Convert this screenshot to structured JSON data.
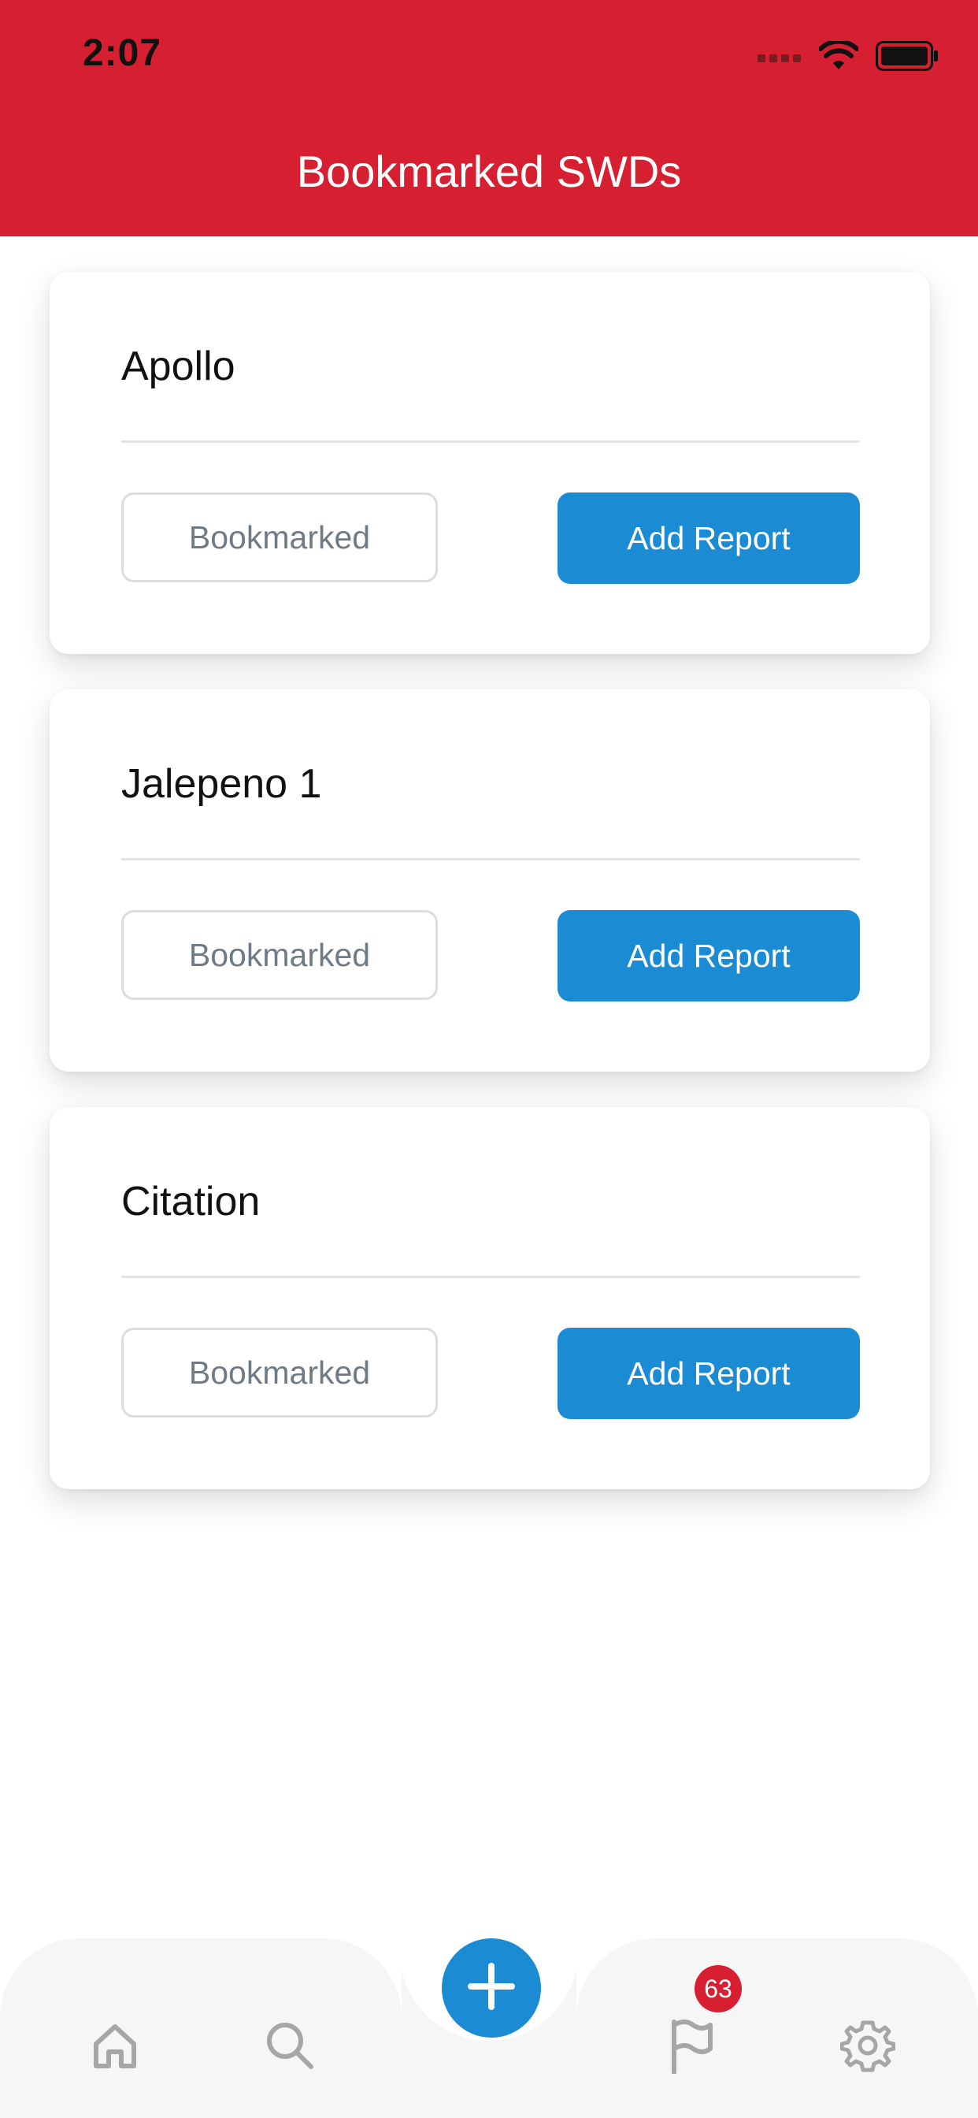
{
  "status_bar": {
    "time": "2:07"
  },
  "header": {
    "title": "Bookmarked SWDs",
    "color": "#d61f31"
  },
  "cards": [
    {
      "name": "Apollo",
      "bookmarked_label": "Bookmarked",
      "add_report_label": "Add Report"
    },
    {
      "name": "Jalepeno 1",
      "bookmarked_label": "Bookmarked",
      "add_report_label": "Add Report"
    },
    {
      "name": "Citation",
      "bookmarked_label": "Bookmarked",
      "add_report_label": "Add Report"
    }
  ],
  "tab_bar": {
    "items": [
      {
        "icon": "home-icon"
      },
      {
        "icon": "search-icon"
      },
      {
        "icon": "add-icon"
      },
      {
        "icon": "flag-icon",
        "badge": "63"
      },
      {
        "icon": "gear-icon"
      }
    ],
    "accent_color": "#1b8bd3"
  }
}
